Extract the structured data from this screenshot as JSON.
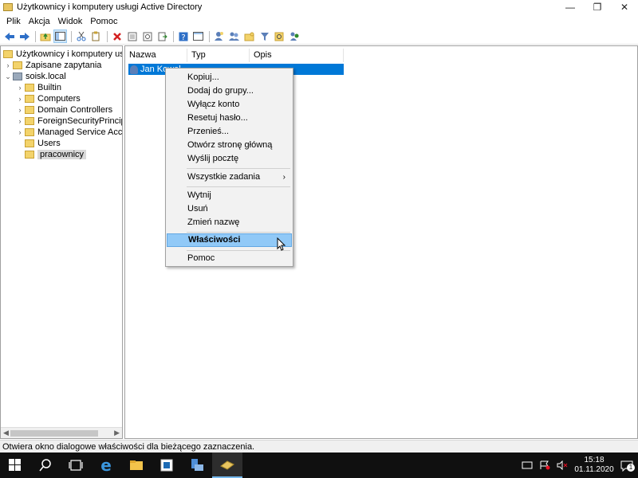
{
  "window": {
    "title": "Użytkownicy i komputery usługi Active Directory",
    "controls": {
      "minimize": "—",
      "restore": "❐",
      "close": "✕"
    }
  },
  "menubar": {
    "items": [
      "Plik",
      "Akcja",
      "Widok",
      "Pomoc"
    ]
  },
  "toolbar": {
    "icons": [
      "back-arrow-icon",
      "forward-arrow-icon",
      "up-folder-icon",
      "show-tree-icon",
      "cut-icon",
      "copy-icon",
      "delete-icon",
      "properties-icon",
      "refresh-icon",
      "export-icon",
      "help-icon",
      "console-icon",
      "new-user-icon",
      "new-group-icon",
      "new-ou-icon",
      "filter-icon",
      "find-icon",
      "add-to-group-icon"
    ]
  },
  "tree": {
    "items": [
      {
        "label": "Użytkownicy i komputery usługi",
        "level": 0,
        "arrow": "",
        "icon": "ad-root-icon"
      },
      {
        "label": "Zapisane zapytania",
        "level": 1,
        "arrow": "›",
        "icon": "folder-icon"
      },
      {
        "label": "soisk.local",
        "level": 1,
        "arrow": "⌄",
        "icon": "domain-icon"
      },
      {
        "label": "Builtin",
        "level": 2,
        "arrow": "›",
        "icon": "folder-icon"
      },
      {
        "label": "Computers",
        "level": 2,
        "arrow": "›",
        "icon": "folder-icon"
      },
      {
        "label": "Domain Controllers",
        "level": 2,
        "arrow": "›",
        "icon": "ou-icon"
      },
      {
        "label": "ForeignSecurityPrincipals",
        "level": 2,
        "arrow": "›",
        "icon": "folder-icon"
      },
      {
        "label": "Managed Service Accour",
        "level": 2,
        "arrow": "›",
        "icon": "folder-icon"
      },
      {
        "label": "Users",
        "level": 2,
        "arrow": "",
        "icon": "folder-icon"
      },
      {
        "label": "pracownicy",
        "level": 2,
        "arrow": "",
        "icon": "ou-icon",
        "selected": true
      }
    ]
  },
  "content": {
    "columns": [
      "Nazwa",
      "Typ",
      "Opis"
    ],
    "rows": [
      {
        "name": "Jan Kowal",
        "type": "",
        "desc": ""
      }
    ]
  },
  "context_menu": {
    "items": [
      {
        "label": "Kopiuj..."
      },
      {
        "label": "Dodaj do grupy..."
      },
      {
        "label": "Wyłącz konto"
      },
      {
        "label": "Resetuj hasło..."
      },
      {
        "label": "Przenieś..."
      },
      {
        "label": "Otwórz stronę główną"
      },
      {
        "label": "Wyślij pocztę"
      },
      {
        "label": "Wszystkie zadania",
        "submenu": "›"
      },
      {
        "label": "Wytnij"
      },
      {
        "label": "Usuń"
      },
      {
        "label": "Zmień nazwę"
      },
      {
        "label": "Właściwości",
        "highlighted": true
      },
      {
        "label": "Pomoc"
      }
    ]
  },
  "statusbar": {
    "text": "Otwiera okno dialogowe właściwości dla bieżącego zaznaczenia."
  },
  "taskbar": {
    "buttons": [
      "windows-start-icon",
      "search-icon",
      "task-view-icon",
      "edge-icon",
      "file-explorer-icon",
      "server-manager-icon",
      "ad-tools-icon",
      "ad-users-computers-icon"
    ],
    "clock": {
      "time": "15:18",
      "date": "01.11.2020"
    },
    "notification_count": "1"
  },
  "colors": {
    "selection": "#0078d7",
    "menu_hover": "#91c9f7",
    "taskbar": "#101010"
  }
}
